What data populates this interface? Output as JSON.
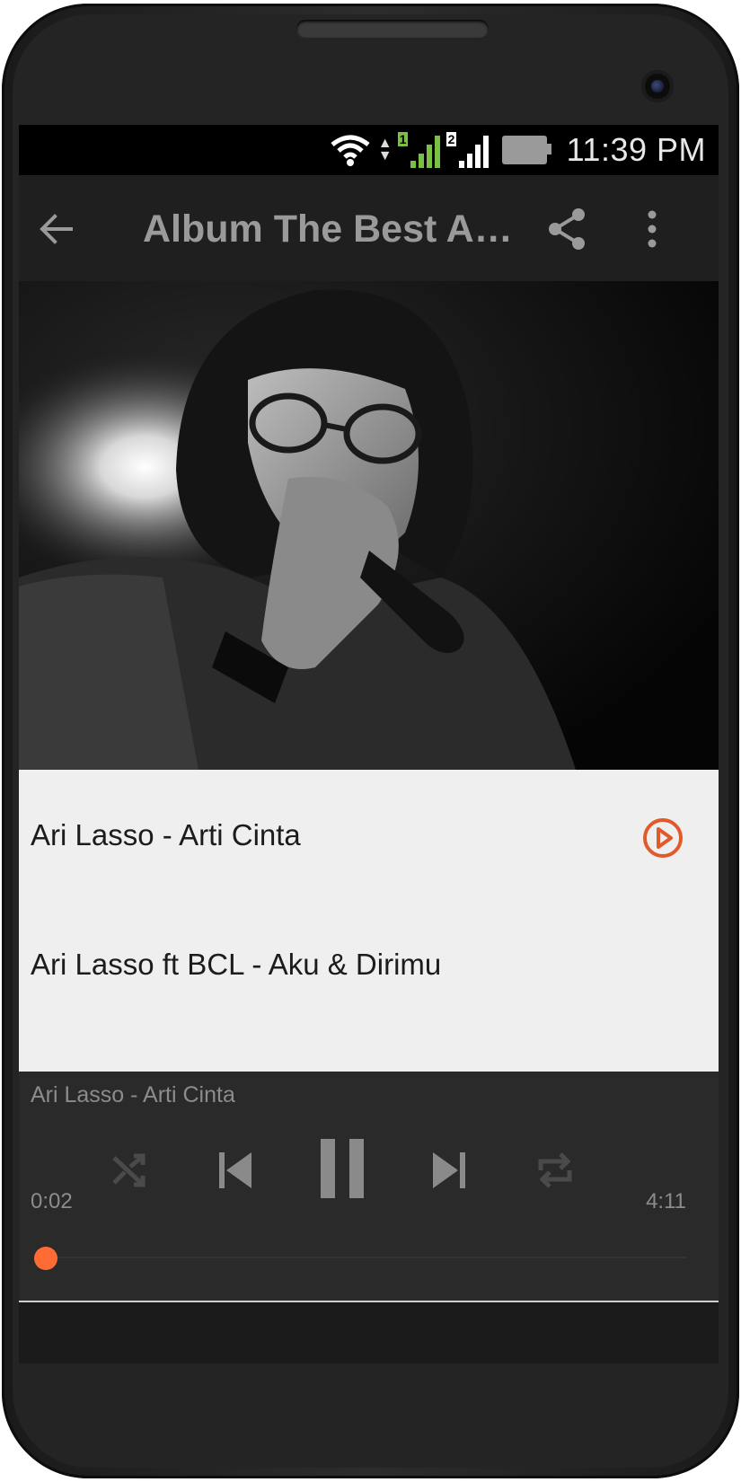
{
  "status": {
    "time": "11:39 PM",
    "sim1": "1",
    "sim2": "2"
  },
  "appbar": {
    "title": "Album The Best Ari…",
    "back_icon": "arrow-back-icon",
    "share_icon": "share-icon",
    "more_icon": "more-vert-icon"
  },
  "tracks": [
    {
      "title": "Ari Lasso - Arti Cinta"
    },
    {
      "title": "Ari Lasso ft BCL - Aku & Dirimu"
    }
  ],
  "player": {
    "now_playing": "Ari Lasso - Arti Cinta",
    "elapsed": "0:02",
    "duration": "4:11",
    "progress": 0.008
  },
  "colors": {
    "accent": "#ff6b35",
    "play_icon": "#e05a2a"
  }
}
